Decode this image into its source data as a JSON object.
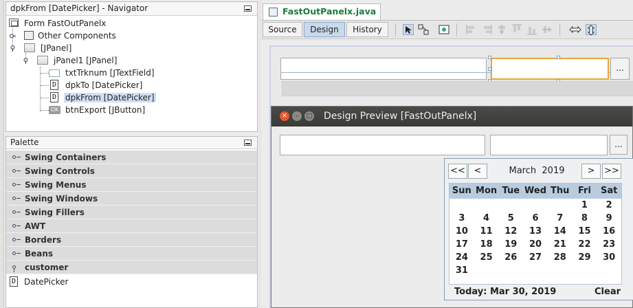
{
  "navigator": {
    "title": "dpkFrom [DatePicker] - Navigator",
    "nodes": [
      {
        "label": "Form FastOutPanelx"
      },
      {
        "label": "Other Components"
      },
      {
        "label": "[JPanel]"
      },
      {
        "label": "jPanel1 [JPanel]"
      },
      {
        "label": "txtTrknum [JTextField]"
      },
      {
        "label": "dpkTo [DatePicker]"
      },
      {
        "label": "dpkFrom [DatePicker]"
      },
      {
        "label": "btnExport [JButton]"
      }
    ],
    "ok_icon_text": "OK",
    "d_icon_text": "D"
  },
  "palette": {
    "title": "Palette",
    "categories": [
      {
        "label": "Swing Containers"
      },
      {
        "label": "Swing Controls"
      },
      {
        "label": "Swing Menus"
      },
      {
        "label": "Swing Windows"
      },
      {
        "label": "Swing Fillers"
      },
      {
        "label": "AWT"
      },
      {
        "label": "Borders"
      },
      {
        "label": "Beans"
      },
      {
        "label": "customer"
      }
    ],
    "items": [
      {
        "label": "DatePicker"
      }
    ]
  },
  "editor": {
    "file_tab": "FastOutPanelx.java",
    "views": {
      "source": "Source",
      "design": "Design",
      "history": "History"
    },
    "active_view": "Design",
    "ellipsis_button": "..."
  },
  "preview": {
    "title": "Design Preview [FastOutPanelx]",
    "ellipsis_button": "...",
    "calendar": {
      "nav_prev_year": "<<",
      "nav_prev_month": "<",
      "nav_next_month": ">",
      "nav_next_year": ">>",
      "month": "March",
      "year": "2019",
      "weekdays": [
        "Sun",
        "Mon",
        "Tue",
        "Wed",
        "Thu",
        "Fri",
        "Sat"
      ],
      "weeks": [
        [
          "",
          "",
          "",
          "",
          "",
          "1",
          "2"
        ],
        [
          "3",
          "4",
          "5",
          "6",
          "7",
          "8",
          "9"
        ],
        [
          "10",
          "11",
          "12",
          "13",
          "14",
          "15",
          "16"
        ],
        [
          "17",
          "18",
          "19",
          "20",
          "21",
          "22",
          "23"
        ],
        [
          "24",
          "25",
          "26",
          "27",
          "28",
          "29",
          "30"
        ],
        [
          "31",
          "",
          "",
          "",
          "",
          "",
          ""
        ]
      ],
      "today_label": "Today:  Mar 30, 2019",
      "clear_label": "Clear"
    }
  },
  "colors": {
    "accent_blue": "#c9d9ec",
    "file_tab_text": "#1a7a3a",
    "calendar_header": "#b8cce0",
    "title_bar_dark": "#3a3a37"
  }
}
